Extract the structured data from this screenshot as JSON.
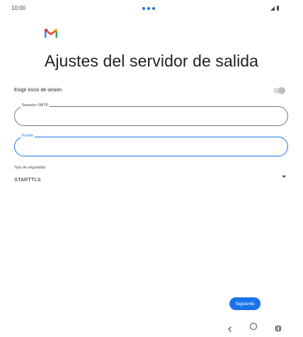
{
  "status_bar": {
    "time": "10:00",
    "icons": [
      "notification-dots-icon",
      "signal-icon",
      "battery-icon"
    ]
  },
  "app": {
    "logo": "gmail-logo-icon"
  },
  "page": {
    "title": "Ajustes del servidor de salida"
  },
  "login_toggle": {
    "label": "Exigir inicio de sesión",
    "state": "off"
  },
  "smtp_field": {
    "label": "Servidor SMTP",
    "value": ""
  },
  "port_field": {
    "label": "Puerto",
    "value": ""
  },
  "security": {
    "label": "Tipo de seguridad",
    "selected": "STARTTLS"
  },
  "next_button": {
    "label": "Siguiente"
  },
  "nav_bar": {
    "icons": [
      "back-icon",
      "home-icon",
      "recents-icon"
    ]
  },
  "colors": {
    "accent": "#1a73e8",
    "gmail_red": "#ea4335",
    "gmail_blue": "#4285f4",
    "gmail_green": "#34a853",
    "gmail_yellow": "#fbbc04"
  }
}
